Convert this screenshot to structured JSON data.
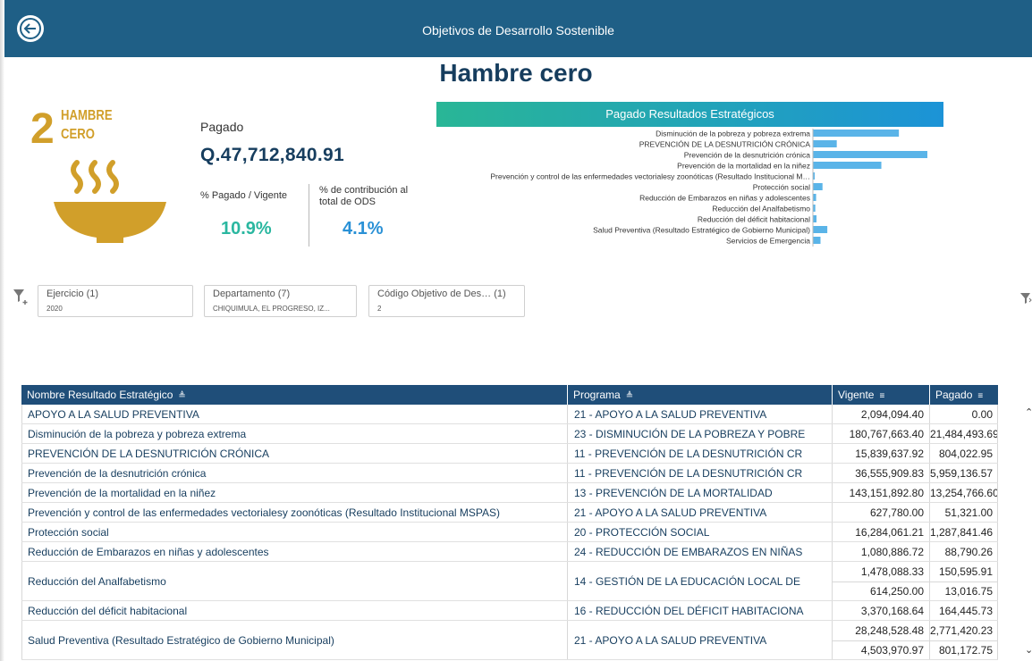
{
  "header": {
    "title": "Objetivos de Desarrollo Sostenible",
    "back_icon": "arrow-left-icon"
  },
  "page_title": "Hambre cero",
  "sdg": {
    "number": "2",
    "word1": "HAMBRE",
    "word2": "CERO",
    "icon": "bowl-icon",
    "color": "#d19f2a"
  },
  "kpi": {
    "paid_label": "Pagado",
    "paid_value": "Q.47,712,840.91",
    "pct_paid_label": "% Pagado / Vigente",
    "pct_paid_value": "10.9%",
    "pct_contrib_label": "% de contribución al total de ODS",
    "pct_contrib_value": "4.1%"
  },
  "chart_data": {
    "type": "bar",
    "orientation": "horizontal",
    "title": "Pagado Resultados Estratégicos",
    "categories": [
      "Disminución de la pobreza y pobreza extrema",
      "PREVENCIÓN DE LA DESNUTRICIÓN CRÓNICA",
      "Prevención de la desnutrición crónica",
      "Prevención de la mortalidad en la niñez",
      "Prevención y control de las enfermedades vectorialesy zoonóticas (Resultado Institucional M…",
      "Protección social",
      "Reducción de Embarazos en niñas y adolescentes",
      "Reducción del Analfabetismo",
      "Reducción del déficit habitacional",
      "Salud Preventiva (Resultado Estratégico de Gobierno Municipal)",
      "Servicios de Emergencia"
    ],
    "values": [
      21484493.69,
      5959136.57,
      28600000,
      17100000,
      400000,
      2400000,
      800000,
      600000,
      900000,
      3600000,
      1900000
    ],
    "color": "#5ab4e8"
  },
  "filters": [
    {
      "label": "Ejercicio (1)",
      "value": "2020"
    },
    {
      "label": "Departamento (7)",
      "value": "CHIQUIMULA, EL PROGRESO, IZ..."
    },
    {
      "label": "Código Objetivo de Des… (1)",
      "value": "2"
    }
  ],
  "table": {
    "columns": [
      "Nombre Resultado Estratégico",
      "Programa",
      "Vigente",
      "Pagado"
    ],
    "rows": [
      {
        "name": "APOYO A LA SALUD PREVENTIVA",
        "program": "21 - APOYO A LA SALUD PREVENTIVA",
        "vigente": [
          "2,094,094.40"
        ],
        "pagado": [
          "0.00"
        ]
      },
      {
        "name": "Disminución de la pobreza y pobreza extrema",
        "program": "23 - DISMINUCIÓN DE LA POBREZA Y POBRE",
        "vigente": [
          "180,767,663.40"
        ],
        "pagado": [
          "21,484,493.69"
        ]
      },
      {
        "name": "PREVENCIÓN DE LA DESNUTRICIÓN CRÓNICA",
        "program": "11 - PREVENCIÓN DE LA DESNUTRICIÓN CR",
        "vigente": [
          "15,839,637.92"
        ],
        "pagado": [
          "804,022.95"
        ]
      },
      {
        "name": "Prevención de la desnutrición crónica",
        "program": "11 - PREVENCIÓN DE LA DESNUTRICIÓN CR",
        "vigente": [
          "36,555,909.83"
        ],
        "pagado": [
          "5,959,136.57"
        ]
      },
      {
        "name": "Prevención de la mortalidad en la niñez",
        "program": "13 - PREVENCIÓN DE LA MORTALIDAD",
        "vigente": [
          "143,151,892.80"
        ],
        "pagado": [
          "13,254,766.60"
        ]
      },
      {
        "name": "Prevención y control de las enfermedades vectorialesy zoonóticas (Resultado Institucional MSPAS)",
        "program": "21 - APOYO A LA SALUD PREVENTIVA",
        "vigente": [
          "627,780.00"
        ],
        "pagado": [
          "51,321.00"
        ]
      },
      {
        "name": "Protección social",
        "program": "20 - PROTECCIÓN SOCIAL",
        "vigente": [
          "16,284,061.21"
        ],
        "pagado": [
          "1,287,841.46"
        ]
      },
      {
        "name": "Reducción de Embarazos en niñas y adolescentes",
        "program": "24 - REDUCCIÓN DE EMBARAZOS EN NIÑAS",
        "vigente": [
          "1,080,886.72"
        ],
        "pagado": [
          "88,790.26"
        ]
      },
      {
        "name": "Reducción del Analfabetismo",
        "program": "14 - GESTIÓN DE LA EDUCACIÓN LOCAL DE",
        "vigente": [
          "1,478,088.33",
          "614,250.00"
        ],
        "pagado": [
          "150,595.91",
          "13,016.75"
        ]
      },
      {
        "name": "Reducción del déficit habitacional",
        "program": "16 - REDUCCIÓN DEL DÉFICIT HABITACIONA",
        "vigente": [
          "3,370,168.64"
        ],
        "pagado": [
          "164,445.73"
        ]
      },
      {
        "name": "Salud Preventiva (Resultado Estratégico de Gobierno Municipal)",
        "program": "21 - APOYO A LA SALUD PREVENTIVA",
        "vigente": [
          "28,248,528.48",
          "4,503,970.97"
        ],
        "pagado": [
          "2,771,420.23",
          "801,172.75"
        ]
      }
    ]
  }
}
